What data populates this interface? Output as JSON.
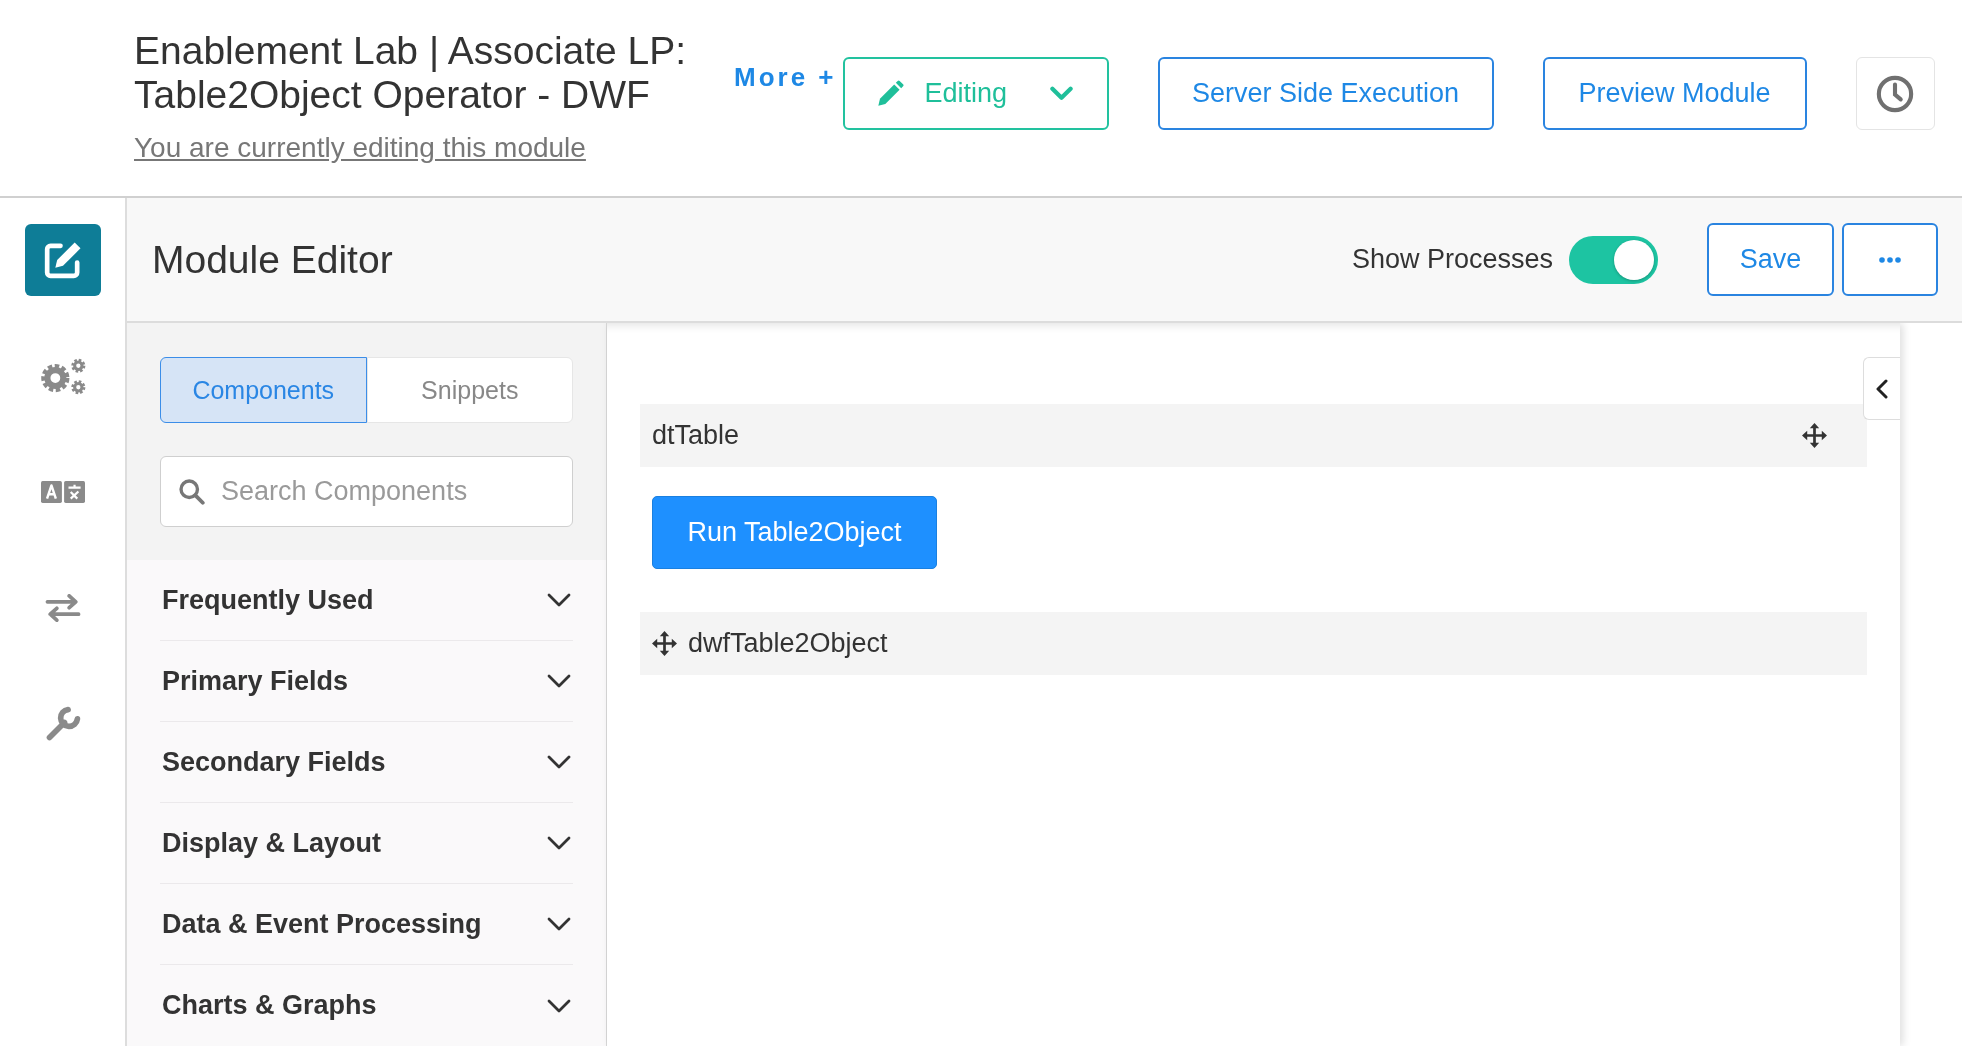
{
  "header": {
    "title": "Enablement Lab | Associate LP: Table2Object Operator - DWF",
    "subtitle": "You are currently editing this module",
    "more_link": "More +",
    "mode_dropdown": {
      "label": "Editing"
    },
    "buttons": [
      "Server Side Execution",
      "Preview Module"
    ]
  },
  "sidebar": {
    "items": [
      {
        "selected": true
      },
      {
        "selected": false
      },
      {
        "selected": false
      },
      {
        "selected": false
      },
      {
        "selected": false
      }
    ]
  },
  "editor_bar": {
    "title": "Module Editor",
    "show_processes": {
      "label": "Show Processes",
      "on": true
    },
    "save_button": "Save"
  },
  "palette": {
    "tabs": [
      {
        "label": "Components",
        "selected": true
      },
      {
        "label": "Snippets",
        "selected": false
      }
    ],
    "search": {
      "placeholder": "Search Components"
    },
    "sections": [
      {
        "label": "Frequently Used",
        "expanded": false
      },
      {
        "label": "Primary Fields",
        "expanded": false
      },
      {
        "label": "Secondary Fields",
        "expanded": false
      },
      {
        "label": "Display & Layout",
        "expanded": false
      },
      {
        "label": "Data & Event Processing",
        "expanded": false
      },
      {
        "label": "Charts & Graphs",
        "expanded": false
      }
    ]
  },
  "canvas": {
    "components": [
      {
        "kind": "table",
        "label": "dtTable"
      },
      {
        "kind": "button",
        "label": "Run Table2Object"
      },
      {
        "kind": "process",
        "label": "dwfTable2Object"
      }
    ]
  }
}
